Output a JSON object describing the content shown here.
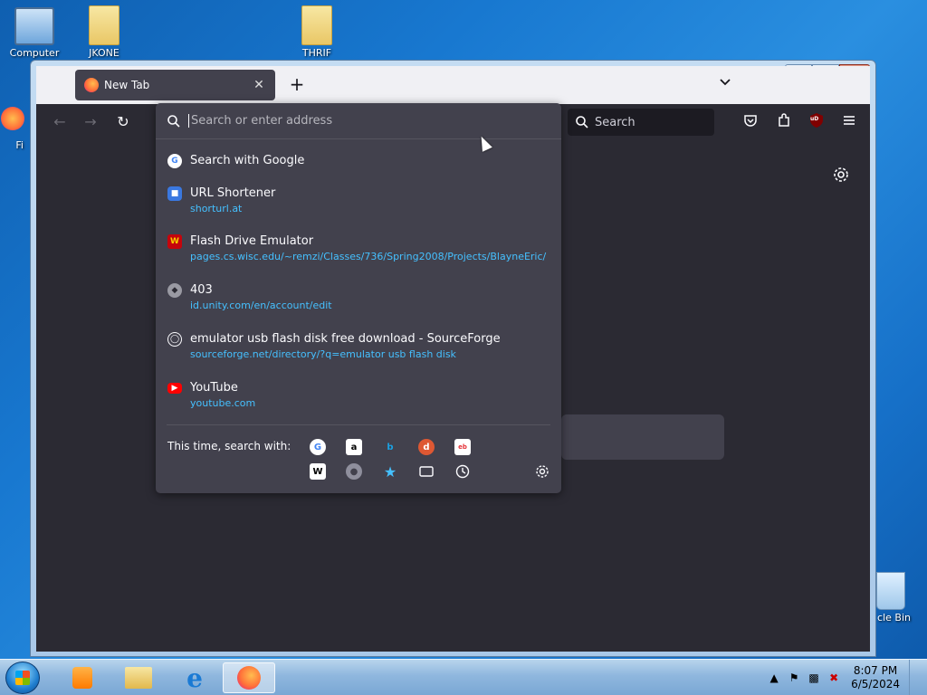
{
  "desktop": {
    "icons": [
      {
        "label": "Computer"
      },
      {
        "label": "JKONE"
      },
      {
        "label": "THRIF"
      },
      {
        "label": "Fi"
      },
      {
        "label": "cle Bin"
      }
    ]
  },
  "browser": {
    "tab": {
      "title": "New Tab"
    },
    "search_placeholder": "Search",
    "url_placeholder": "Search or enter address",
    "results": [
      {
        "title": "Search with Google",
        "url": ""
      },
      {
        "title": "URL Shortener",
        "url": "shorturl.at"
      },
      {
        "title": "Flash Drive Emulator",
        "url": "pages.cs.wisc.edu/~remzi/Classes/736/Spring2008/Projects/BlayneEric/"
      },
      {
        "title": "403",
        "url": "id.unity.com/en/account/edit"
      },
      {
        "title": "emulator usb flash disk free download - SourceForge",
        "url": "sourceforge.net/directory/?q=emulator usb flash disk"
      },
      {
        "title": "YouTube",
        "url": "youtube.com"
      }
    ],
    "oneoff_label": "This time, search with:",
    "engines": [
      "google",
      "amazon",
      "bing",
      "duckduckgo",
      "ebay",
      "wikipedia"
    ],
    "ublock_badge": "uD"
  },
  "taskbar": {
    "time": "8:07 PM",
    "date": "6/5/2024"
  },
  "colors": {
    "url_link": "#45c0ff",
    "panel": "#42414d",
    "toolbar": "#2b2a33"
  }
}
